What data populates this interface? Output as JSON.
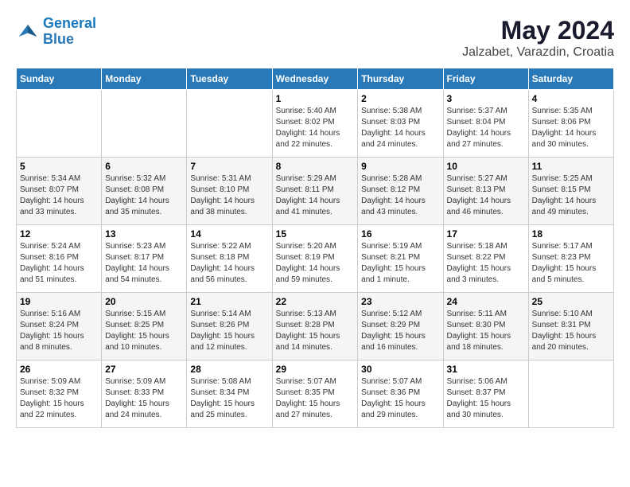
{
  "header": {
    "logo_line1": "General",
    "logo_line2": "Blue",
    "month_title": "May 2024",
    "location": "Jalzabet, Varazdin, Croatia"
  },
  "calendar": {
    "headers": [
      "Sunday",
      "Monday",
      "Tuesday",
      "Wednesday",
      "Thursday",
      "Friday",
      "Saturday"
    ],
    "weeks": [
      {
        "days": [
          {
            "num": "",
            "info": ""
          },
          {
            "num": "",
            "info": ""
          },
          {
            "num": "",
            "info": ""
          },
          {
            "num": "1",
            "info": "Sunrise: 5:40 AM\nSunset: 8:02 PM\nDaylight: 14 hours\nand 22 minutes."
          },
          {
            "num": "2",
            "info": "Sunrise: 5:38 AM\nSunset: 8:03 PM\nDaylight: 14 hours\nand 24 minutes."
          },
          {
            "num": "3",
            "info": "Sunrise: 5:37 AM\nSunset: 8:04 PM\nDaylight: 14 hours\nand 27 minutes."
          },
          {
            "num": "4",
            "info": "Sunrise: 5:35 AM\nSunset: 8:06 PM\nDaylight: 14 hours\nand 30 minutes."
          }
        ]
      },
      {
        "days": [
          {
            "num": "5",
            "info": "Sunrise: 5:34 AM\nSunset: 8:07 PM\nDaylight: 14 hours\nand 33 minutes."
          },
          {
            "num": "6",
            "info": "Sunrise: 5:32 AM\nSunset: 8:08 PM\nDaylight: 14 hours\nand 35 minutes."
          },
          {
            "num": "7",
            "info": "Sunrise: 5:31 AM\nSunset: 8:10 PM\nDaylight: 14 hours\nand 38 minutes."
          },
          {
            "num": "8",
            "info": "Sunrise: 5:29 AM\nSunset: 8:11 PM\nDaylight: 14 hours\nand 41 minutes."
          },
          {
            "num": "9",
            "info": "Sunrise: 5:28 AM\nSunset: 8:12 PM\nDaylight: 14 hours\nand 43 minutes."
          },
          {
            "num": "10",
            "info": "Sunrise: 5:27 AM\nSunset: 8:13 PM\nDaylight: 14 hours\nand 46 minutes."
          },
          {
            "num": "11",
            "info": "Sunrise: 5:25 AM\nSunset: 8:15 PM\nDaylight: 14 hours\nand 49 minutes."
          }
        ]
      },
      {
        "days": [
          {
            "num": "12",
            "info": "Sunrise: 5:24 AM\nSunset: 8:16 PM\nDaylight: 14 hours\nand 51 minutes."
          },
          {
            "num": "13",
            "info": "Sunrise: 5:23 AM\nSunset: 8:17 PM\nDaylight: 14 hours\nand 54 minutes."
          },
          {
            "num": "14",
            "info": "Sunrise: 5:22 AM\nSunset: 8:18 PM\nDaylight: 14 hours\nand 56 minutes."
          },
          {
            "num": "15",
            "info": "Sunrise: 5:20 AM\nSunset: 8:19 PM\nDaylight: 14 hours\nand 59 minutes."
          },
          {
            "num": "16",
            "info": "Sunrise: 5:19 AM\nSunset: 8:21 PM\nDaylight: 15 hours\nand 1 minute."
          },
          {
            "num": "17",
            "info": "Sunrise: 5:18 AM\nSunset: 8:22 PM\nDaylight: 15 hours\nand 3 minutes."
          },
          {
            "num": "18",
            "info": "Sunrise: 5:17 AM\nSunset: 8:23 PM\nDaylight: 15 hours\nand 5 minutes."
          }
        ]
      },
      {
        "days": [
          {
            "num": "19",
            "info": "Sunrise: 5:16 AM\nSunset: 8:24 PM\nDaylight: 15 hours\nand 8 minutes."
          },
          {
            "num": "20",
            "info": "Sunrise: 5:15 AM\nSunset: 8:25 PM\nDaylight: 15 hours\nand 10 minutes."
          },
          {
            "num": "21",
            "info": "Sunrise: 5:14 AM\nSunset: 8:26 PM\nDaylight: 15 hours\nand 12 minutes."
          },
          {
            "num": "22",
            "info": "Sunrise: 5:13 AM\nSunset: 8:28 PM\nDaylight: 15 hours\nand 14 minutes."
          },
          {
            "num": "23",
            "info": "Sunrise: 5:12 AM\nSunset: 8:29 PM\nDaylight: 15 hours\nand 16 minutes."
          },
          {
            "num": "24",
            "info": "Sunrise: 5:11 AM\nSunset: 8:30 PM\nDaylight: 15 hours\nand 18 minutes."
          },
          {
            "num": "25",
            "info": "Sunrise: 5:10 AM\nSunset: 8:31 PM\nDaylight: 15 hours\nand 20 minutes."
          }
        ]
      },
      {
        "days": [
          {
            "num": "26",
            "info": "Sunrise: 5:09 AM\nSunset: 8:32 PM\nDaylight: 15 hours\nand 22 minutes."
          },
          {
            "num": "27",
            "info": "Sunrise: 5:09 AM\nSunset: 8:33 PM\nDaylight: 15 hours\nand 24 minutes."
          },
          {
            "num": "28",
            "info": "Sunrise: 5:08 AM\nSunset: 8:34 PM\nDaylight: 15 hours\nand 25 minutes."
          },
          {
            "num": "29",
            "info": "Sunrise: 5:07 AM\nSunset: 8:35 PM\nDaylight: 15 hours\nand 27 minutes."
          },
          {
            "num": "30",
            "info": "Sunrise: 5:07 AM\nSunset: 8:36 PM\nDaylight: 15 hours\nand 29 minutes."
          },
          {
            "num": "31",
            "info": "Sunrise: 5:06 AM\nSunset: 8:37 PM\nDaylight: 15 hours\nand 30 minutes."
          },
          {
            "num": "",
            "info": ""
          }
        ]
      }
    ]
  }
}
